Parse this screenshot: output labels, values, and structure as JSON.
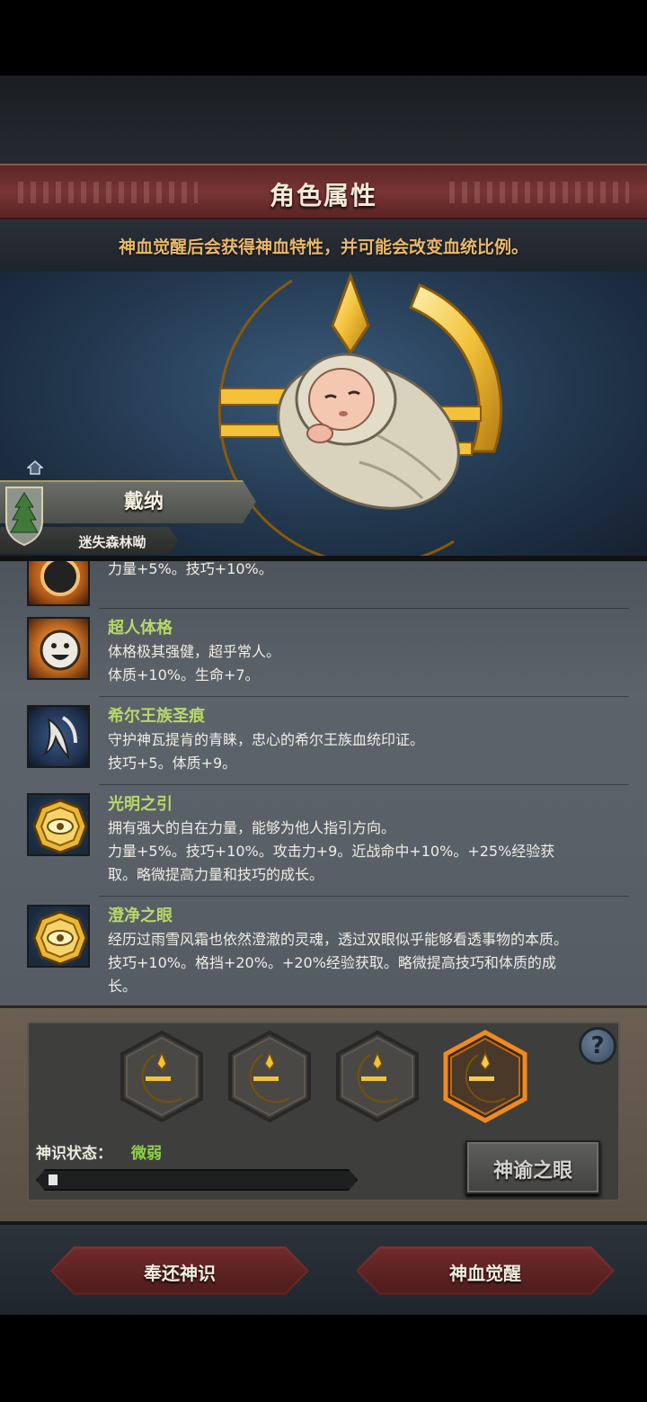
{
  "header": {
    "title": "角色属性"
  },
  "hint": "神血觉醒后会获得神血特性，并可能会改变血统比例。",
  "character": {
    "name": "戴纳",
    "origin": "迷失森林呦"
  },
  "traits": [
    {
      "icon": "eye-sun-icon",
      "name": "",
      "lines": [
        "力量+5%。技巧+10%。"
      ]
    },
    {
      "icon": "smiley-face-icon",
      "name": "超人体格",
      "lines": [
        "体格极其强健，超乎常人。",
        "体质+10%。生命+7。"
      ]
    },
    {
      "icon": "wing-crest-icon",
      "name": "希尔王族圣痕",
      "lines": [
        "守护神瓦提肯的青睐，忠心的希尔王族血统印证。",
        "技巧+5。体质+9。"
      ]
    },
    {
      "icon": "golden-eye-medallion-icon",
      "name": "光明之引",
      "lines": [
        "拥有强大的自在力量，能够为他人指引方向。",
        "力量+5%。技巧+10%。攻击力+9。近战命中+10%。+25%经验获",
        "取。略微提高力量和技巧的成长。"
      ]
    },
    {
      "icon": "golden-eye-medallion-icon",
      "name": "澄净之眼",
      "lines": [
        "经历过雨雪风霜也依然澄澈的灵魂，透过双眼似乎能够看透事物的本质。",
        "技巧+10%。格挡+20%。+20%经验获取。略微提高技巧和体质的成",
        "长。"
      ]
    }
  ],
  "divine_sense": {
    "slots": [
      {
        "icon": "crescent-emblem-icon",
        "active": false
      },
      {
        "icon": "crescent-emblem-icon",
        "active": false
      },
      {
        "icon": "crescent-emblem-icon",
        "active": false
      },
      {
        "icon": "crescent-emblem-icon",
        "active": true
      }
    ],
    "help": "?",
    "state_label": "神识状态：",
    "state_value": "微弱",
    "progress": 0.03,
    "oracle_button": "神谕之眼"
  },
  "buttons": {
    "return": "奉还神识",
    "awaken": "神血觉醒"
  },
  "colors": {
    "accent_gold": "#e9b96b",
    "trait_name": "#b6d86a",
    "state_value": "#8fd14a",
    "button_red": "#7a3232"
  }
}
